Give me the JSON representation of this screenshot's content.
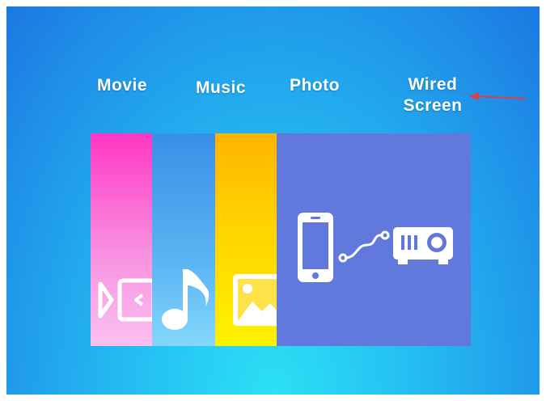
{
  "menu": {
    "items": [
      {
        "label": "Movie",
        "icon": "video-icon"
      },
      {
        "label": "Music",
        "icon": "music-note-icon"
      },
      {
        "label": "Photo",
        "icon": "image-icon"
      },
      {
        "label_line1": "Wired",
        "label_line2": "Screen",
        "icon": "phone-to-projector-icon"
      }
    ],
    "selected_index": 3
  },
  "colors": {
    "background": "#1f8fe8",
    "movie_tile": "#ff36c4",
    "music_tile": "#3a8fe6",
    "photo_tile": "#ffd400",
    "wired_tile": "#6179dc",
    "pointer_arrow": "#e0403a"
  }
}
